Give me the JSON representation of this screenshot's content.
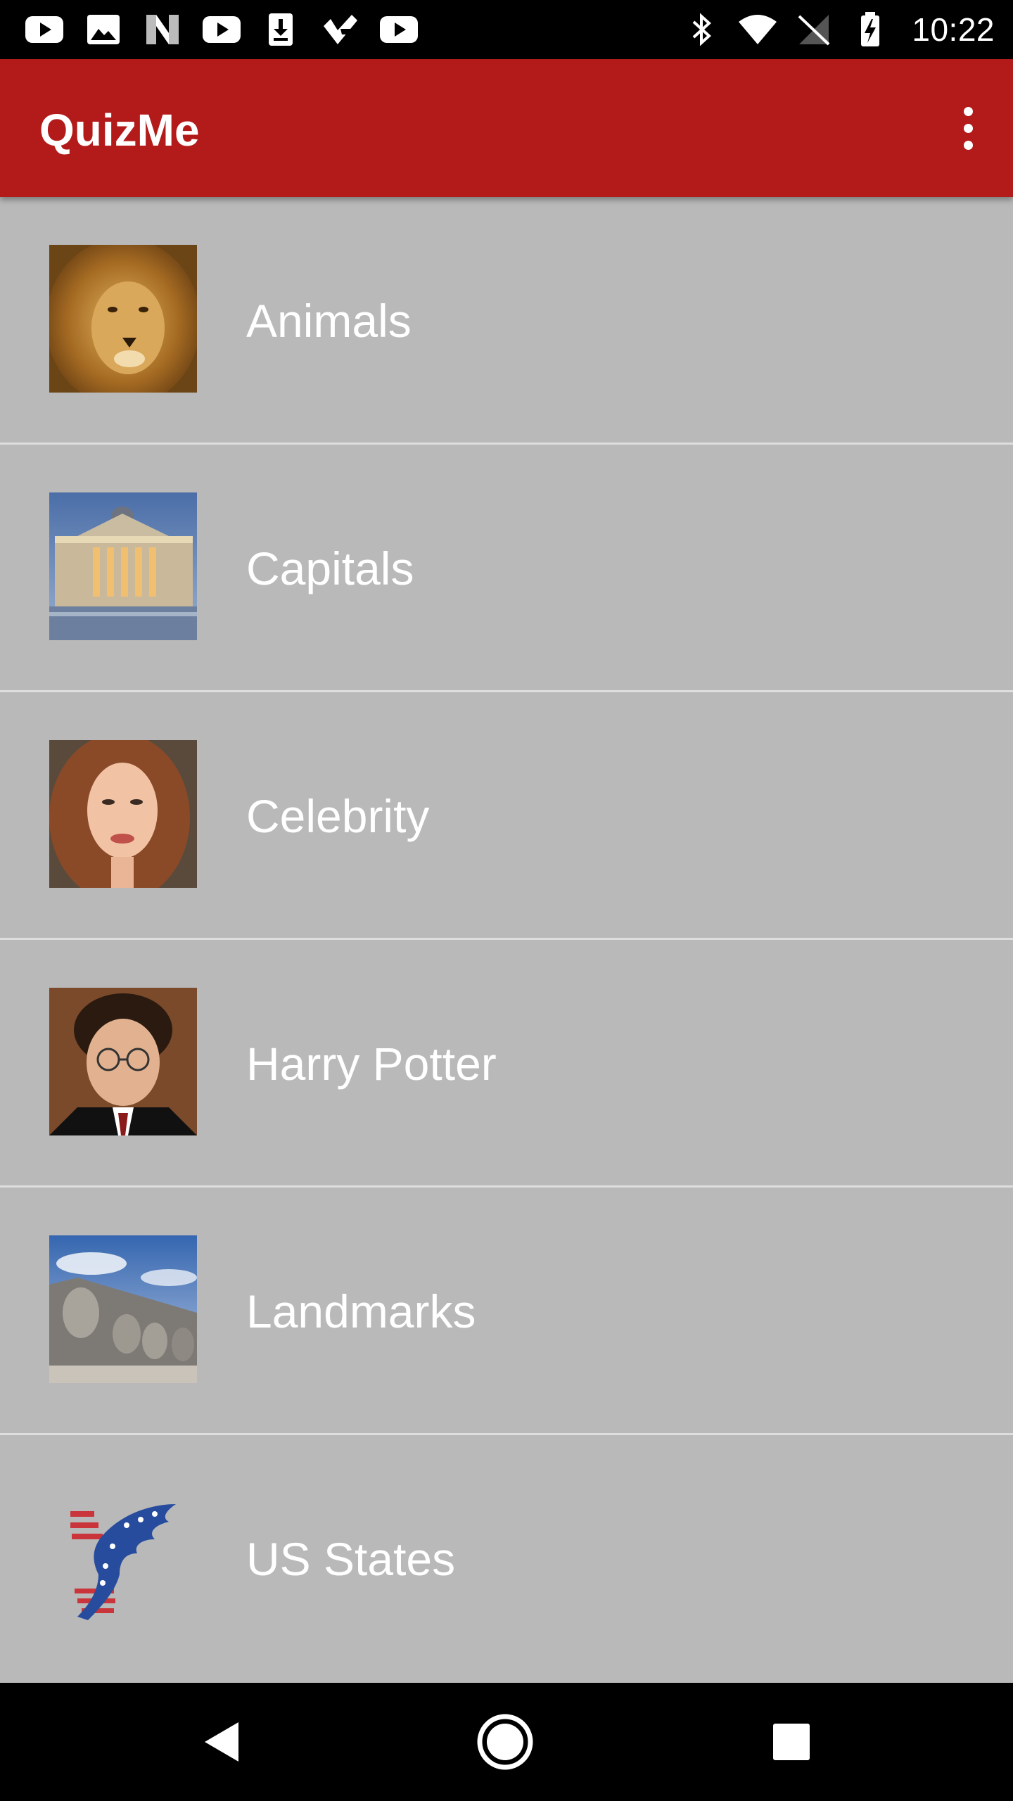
{
  "status_bar": {
    "time": "10:22",
    "left_icons": [
      "youtube-icon",
      "image-icon",
      "n-app-icon",
      "youtube-icon",
      "download-icon",
      "checkmark-app-icon",
      "youtube-icon"
    ],
    "right_icons": [
      "bluetooth-icon",
      "wifi-icon",
      "no-signal-icon",
      "battery-icon"
    ]
  },
  "app_bar": {
    "title": "QuizMe",
    "background": "#b31b1b",
    "menu_icon": "more-vert-icon"
  },
  "quiz_list": {
    "background": "#b9b9b9",
    "items": [
      {
        "label": "Animals",
        "image": "lion-photo"
      },
      {
        "label": "Capitals",
        "image": "building-photo"
      },
      {
        "label": "Celebrity",
        "image": "woman-portrait-photo"
      },
      {
        "label": "Harry Potter",
        "image": "boy-with-glasses-photo"
      },
      {
        "label": "Landmarks",
        "image": "mount-rushmore-photo"
      },
      {
        "label": "US States",
        "image": "eagle-flag-logo"
      }
    ]
  },
  "nav_bar": {
    "buttons": [
      "back-icon",
      "home-icon",
      "recents-icon"
    ]
  }
}
